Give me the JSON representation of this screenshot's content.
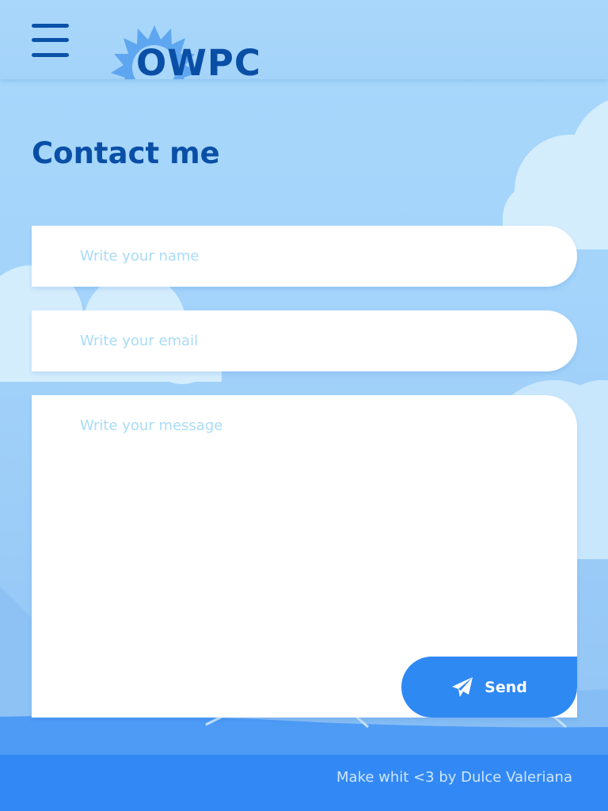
{
  "header": {
    "menu_icon": "hamburger-menu-icon",
    "logo_text": "OWPC",
    "logo_icon": "sun-icon"
  },
  "main": {
    "title": "Contact me",
    "form": {
      "name_placeholder": "Write your name",
      "email_placeholder": "Write your email",
      "message_placeholder": "Write your message",
      "send_label": "Send",
      "send_icon": "paper-plane-icon"
    }
  },
  "footer": {
    "credit": "Make whit <3 by Dulce Valeriana"
  },
  "colors": {
    "primary": "#0a4fa6",
    "accent": "#2f89f3",
    "sky": "#a8d8fb",
    "placeholder": "#a9dbf7"
  }
}
